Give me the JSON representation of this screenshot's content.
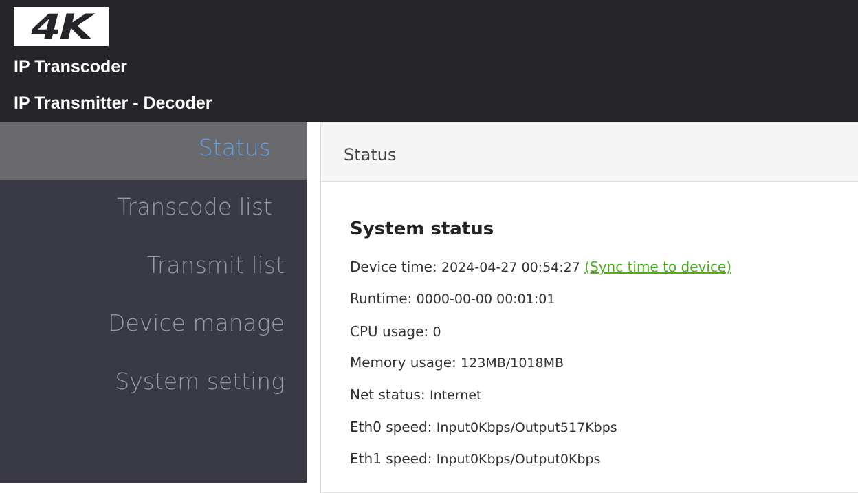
{
  "header": {
    "logo_text": "4K",
    "title_line1": "IP Transcoder",
    "title_line2": "IP Transmitter - Decoder"
  },
  "sidebar": {
    "items": [
      {
        "label": "Status",
        "active": true
      },
      {
        "label": "Transcode list",
        "active": false
      },
      {
        "label": "Transmit list",
        "active": false
      },
      {
        "label": "Device manage",
        "active": false
      },
      {
        "label": "System setting",
        "active": false
      }
    ]
  },
  "main": {
    "panel_title": "Status",
    "section_title": "System status",
    "device_time": {
      "label": "Device time: ",
      "value": "2024-04-27 00:54:27",
      "link": "(Sync time to device)"
    },
    "runtime": {
      "label": "Runtime: ",
      "value": "0000-00-00 00:01:01"
    },
    "cpu": {
      "label": "CPU usage: ",
      "value": "0"
    },
    "memory": {
      "label": "Memory usage: ",
      "value": "123MB/1018MB"
    },
    "net": {
      "label": "Net status: ",
      "value": "Internet"
    },
    "eth0": {
      "label": "Eth0 speed: ",
      "value": "Input0Kbps/Output517Kbps"
    },
    "eth1": {
      "label": "Eth1 speed: ",
      "value": "Input0Kbps/Output0Kbps"
    }
  },
  "colors": {
    "topbar_bg": "#25252a",
    "sidebar_bg": "#393a45",
    "active_item_bg": "#6a6a6e",
    "active_item_text": "#5fa0e8",
    "link": "#4caf1a"
  }
}
